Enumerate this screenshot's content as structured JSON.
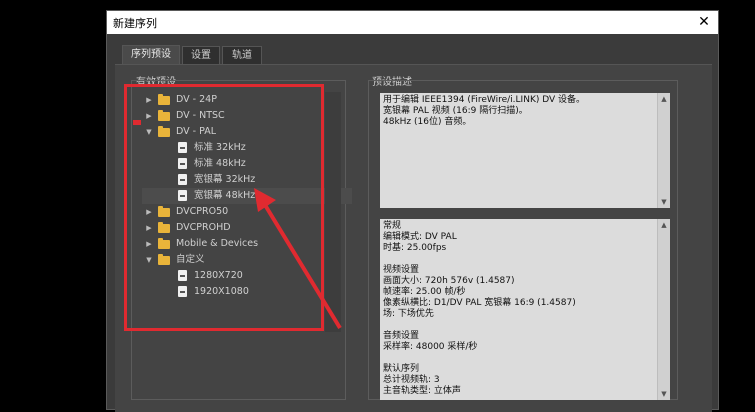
{
  "dialog": {
    "title": "新建序列",
    "close": "✕"
  },
  "tabs": [
    {
      "label": "序列预设",
      "active": true
    },
    {
      "label": "设置",
      "active": false
    },
    {
      "label": "轨道",
      "active": false
    }
  ],
  "presets_group_label": "有效预设",
  "description_group_label": "预设描述",
  "preset_tree": [
    {
      "label": "DV - 24P",
      "type": "folder",
      "expanded": false,
      "level": 0
    },
    {
      "label": "DV - NTSC",
      "type": "folder",
      "expanded": false,
      "level": 0
    },
    {
      "label": "DV - PAL",
      "type": "folder",
      "expanded": true,
      "level": 0
    },
    {
      "label": "标准 32kHz",
      "type": "file",
      "level": 1
    },
    {
      "label": "标准 48kHz",
      "type": "file",
      "level": 1
    },
    {
      "label": "宽银幕 32kHz",
      "type": "file",
      "level": 1
    },
    {
      "label": "宽银幕 48kHz",
      "type": "file",
      "level": 1,
      "selected": true
    },
    {
      "label": "DVCPRO50",
      "type": "folder",
      "expanded": false,
      "level": 0
    },
    {
      "label": "DVCPROHD",
      "type": "folder",
      "expanded": false,
      "level": 0
    },
    {
      "label": "Mobile & Devices",
      "type": "folder",
      "expanded": false,
      "level": 0
    },
    {
      "label": "自定义",
      "type": "folder",
      "expanded": true,
      "level": 0
    },
    {
      "label": "1280X720",
      "type": "file",
      "level": 1
    },
    {
      "label": "1920X1080",
      "type": "file",
      "level": 1
    }
  ],
  "description_top": [
    "用于编辑 IEEE1394 (FireWire/i.LINK) DV 设备。",
    "宽银幕 PAL 视频 (16:9 隔行扫描)。",
    "48kHz (16位) 音频。"
  ],
  "description_bottom": [
    "常规",
    " 编辑模式: DV PAL",
    " 时基: 25.00fps",
    "",
    "视频设置",
    " 画面大小: 720h 576v (1.4587)",
    " 帧速率: 25.00 帧/秒",
    " 像素纵横比: D1/DV PAL 宽银幕 16:9 (1.4587)",
    " 场: 下场优先",
    "",
    "音频设置",
    " 采样率: 48000 采样/秒",
    "",
    "默认序列",
    " 总计视频轨: 3",
    " 主音轨类型: 立体声"
  ],
  "colors": {
    "annotation": "#e02a30",
    "folder": "#e9b43a"
  }
}
